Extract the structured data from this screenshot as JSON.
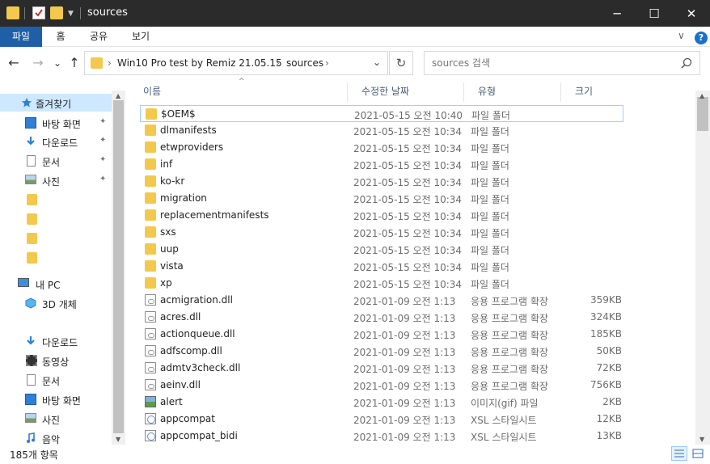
{
  "titlebar": {
    "title": "sources",
    "minimize": "─",
    "maximize": "☐",
    "close": "✕"
  },
  "ribbon": {
    "tabs": [
      "파일",
      "홈",
      "공유",
      "보기"
    ],
    "active_tab": "파일",
    "expand_glyph": "∨",
    "help_glyph": "?"
  },
  "nav": {
    "back": "←",
    "forward": "→",
    "recent": "⌄",
    "up": "↑",
    "refresh": "↻",
    "breadcrumb": [
      "Win10 Pro test by Remiz 21.05.15",
      "sources"
    ],
    "separator": "›",
    "dropdown": "⌄"
  },
  "search": {
    "placeholder": "sources 검색"
  },
  "navpane": {
    "items": [
      {
        "label": "즐겨찾기",
        "icon": "star-icon",
        "pinned": false
      },
      {
        "label": "바탕 화면",
        "icon": "desktop-icon",
        "pinned": true
      },
      {
        "label": "다운로드",
        "icon": "download-icon",
        "pinned": true
      },
      {
        "label": "문서",
        "icon": "documents-icon",
        "pinned": true
      },
      {
        "label": "사진",
        "icon": "pictures-icon",
        "pinned": true
      },
      {
        "label": "",
        "icon": "folder-icon",
        "pinned": false
      },
      {
        "label": "",
        "icon": "folder-icon",
        "pinned": false
      },
      {
        "label": "",
        "icon": "folder-icon",
        "pinned": false
      },
      {
        "label": "",
        "icon": "folder-icon",
        "pinned": false
      },
      {
        "label": "내 PC",
        "icon": "pc-icon",
        "pinned": false
      },
      {
        "label": "3D 개체",
        "icon": "3d-objects-icon",
        "pinned": false
      },
      {
        "label": "다운로드",
        "icon": "download-icon",
        "pinned": false
      },
      {
        "label": "동영상",
        "icon": "videos-icon",
        "pinned": false
      },
      {
        "label": "문서",
        "icon": "documents-icon",
        "pinned": false
      },
      {
        "label": "바탕 화면",
        "icon": "desktop-icon",
        "pinned": false
      },
      {
        "label": "사진",
        "icon": "pictures-icon",
        "pinned": false
      },
      {
        "label": "음악",
        "icon": "music-icon",
        "pinned": false
      }
    ],
    "pin_glyph": "📌"
  },
  "filelist": {
    "columns": {
      "name": "이름",
      "date": "수정한 날짜",
      "type": "유형",
      "size": "크기"
    },
    "sort_glyph": "^",
    "rows": [
      {
        "name": "$OEM$",
        "date": "2021-05-15 오전 10:40",
        "type": "파일 폴더",
        "size": "",
        "kind": "folder"
      },
      {
        "name": "dlmanifests",
        "date": "2021-05-15 오전 10:34",
        "type": "파일 폴더",
        "size": "",
        "kind": "folder"
      },
      {
        "name": "etwproviders",
        "date": "2021-05-15 오전 10:34",
        "type": "파일 폴더",
        "size": "",
        "kind": "folder"
      },
      {
        "name": "inf",
        "date": "2021-05-15 오전 10:34",
        "type": "파일 폴더",
        "size": "",
        "kind": "folder"
      },
      {
        "name": "ko-kr",
        "date": "2021-05-15 오전 10:34",
        "type": "파일 폴더",
        "size": "",
        "kind": "folder"
      },
      {
        "name": "migration",
        "date": "2021-05-15 오전 10:34",
        "type": "파일 폴더",
        "size": "",
        "kind": "folder"
      },
      {
        "name": "replacementmanifests",
        "date": "2021-05-15 오전 10:34",
        "type": "파일 폴더",
        "size": "",
        "kind": "folder"
      },
      {
        "name": "sxs",
        "date": "2021-05-15 오전 10:34",
        "type": "파일 폴더",
        "size": "",
        "kind": "folder"
      },
      {
        "name": "uup",
        "date": "2021-05-15 오전 10:34",
        "type": "파일 폴더",
        "size": "",
        "kind": "folder"
      },
      {
        "name": "vista",
        "date": "2021-05-15 오전 10:34",
        "type": "파일 폴더",
        "size": "",
        "kind": "folder"
      },
      {
        "name": "xp",
        "date": "2021-05-15 오전 10:34",
        "type": "파일 폴더",
        "size": "",
        "kind": "folder"
      },
      {
        "name": "acmigration.dll",
        "date": "2021-01-09 오전 1:13",
        "type": "응용 프로그램 확장",
        "size": "359KB",
        "kind": "dll"
      },
      {
        "name": "acres.dll",
        "date": "2021-01-09 오전 1:13",
        "type": "응용 프로그램 확장",
        "size": "324KB",
        "kind": "dll"
      },
      {
        "name": "actionqueue.dll",
        "date": "2021-01-09 오전 1:13",
        "type": "응용 프로그램 확장",
        "size": "185KB",
        "kind": "dll"
      },
      {
        "name": "adfscomp.dll",
        "date": "2021-01-09 오전 1:13",
        "type": "응용 프로그램 확장",
        "size": "50KB",
        "kind": "dll"
      },
      {
        "name": "admtv3check.dll",
        "date": "2021-01-09 오전 1:13",
        "type": "응용 프로그램 확장",
        "size": "72KB",
        "kind": "dll"
      },
      {
        "name": "aeinv.dll",
        "date": "2021-01-09 오전 1:13",
        "type": "응용 프로그램 확장",
        "size": "756KB",
        "kind": "dll"
      },
      {
        "name": "alert",
        "date": "2021-01-09 오전 1:13",
        "type": "이미지(gif) 파일",
        "size": "2KB",
        "kind": "gif"
      },
      {
        "name": "appcompat",
        "date": "2021-01-09 오전 1:13",
        "type": "XSL 스타일시트",
        "size": "12KB",
        "kind": "xsl"
      },
      {
        "name": "appcompat_bidi",
        "date": "2021-01-09 오전 1:13",
        "type": "XSL 스타일시트",
        "size": "13KB",
        "kind": "xsl"
      }
    ]
  },
  "statusbar": {
    "item_count": "185개 항목"
  },
  "colors": {
    "titlebar_bg": "#2b2b2b",
    "active_tab": "#1f5fa8",
    "selection": "#cde8ff",
    "folder": "#f2c94c"
  }
}
